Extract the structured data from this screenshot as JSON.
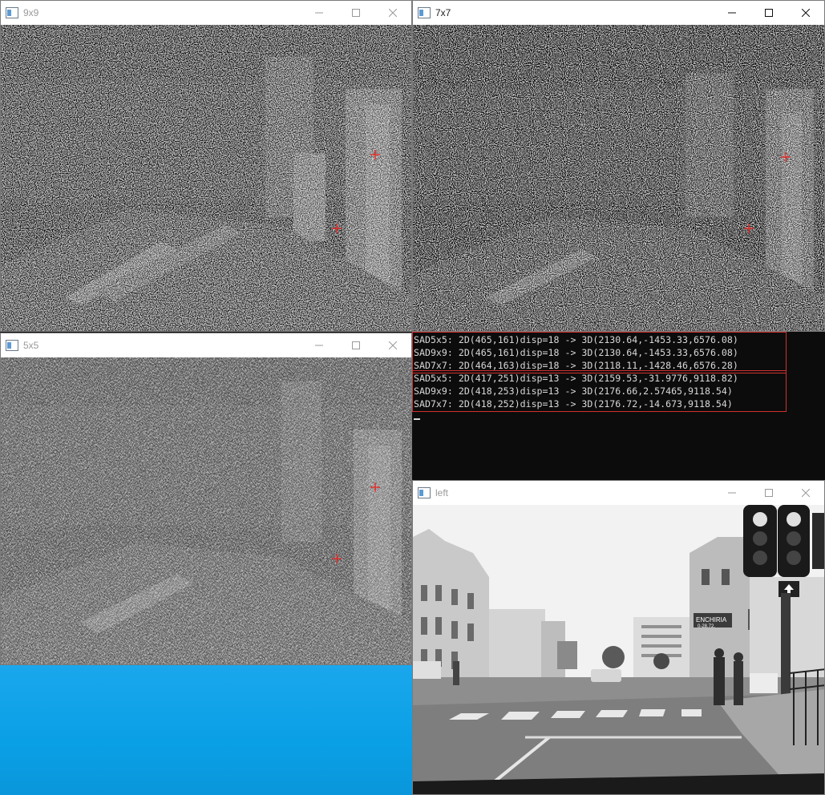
{
  "windows": {
    "w9x9": {
      "title": "9x9"
    },
    "w7x7": {
      "title": "7x7"
    },
    "w5x5": {
      "title": "5x5"
    },
    "left": {
      "title": "left"
    }
  },
  "console": {
    "group1": [
      "SAD5x5: 2D(465,161)disp=18 -> 3D(2130.64,-1453.33,6576.08)",
      "SAD9x9: 2D(465,161)disp=18 -> 3D(2130.64,-1453.33,6576.08)",
      "SAD7x7: 2D(464,163)disp=18 -> 3D(2118.11,-1428.46,6576.28)"
    ],
    "group2": [
      "SAD5x5: 2D(417,251)disp=13 -> 3D(2159.53,-31.9776,9118.82)",
      "SAD9x9: 2D(418,253)disp=13 -> 3D(2176.66,2.57465,9118.54)",
      "SAD7x7: 2D(418,252)disp=13 -> 3D(2176.72,-14.673,9118.54)"
    ]
  },
  "scene": {
    "shop_sign": "ENCHIRIA",
    "shop_phone": "0-28.72."
  },
  "colors": {
    "marker": "#e0322e",
    "console_border": "#d0312d",
    "desktop": "#0aa0e6"
  }
}
